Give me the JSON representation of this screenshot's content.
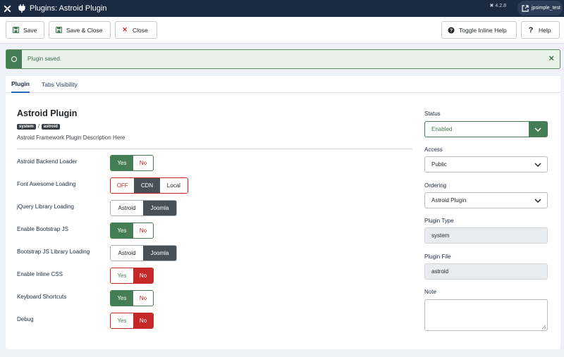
{
  "header": {
    "title": "Plugins: Astroid Plugin",
    "version": "4.2.8",
    "user": "jpsimple_test"
  },
  "toolbar": {
    "save": "Save",
    "save_close": "Save & Close",
    "close": "Close",
    "toggle_help": "Toggle Inline Help",
    "help": "Help"
  },
  "alert": {
    "message": "Plugin saved.",
    "close": "×"
  },
  "tabs": [
    {
      "label": "Plugin",
      "active": true
    },
    {
      "label": "Tabs Visibility",
      "active": false
    }
  ],
  "plugin": {
    "title": "Astroid Plugin",
    "badges": [
      "system",
      "astroid"
    ],
    "separator": "/",
    "description": "Astroid Framework Plugin Description Here"
  },
  "fields": [
    {
      "label": "Astroid Backend Loader",
      "options": [
        "Yes",
        "No"
      ],
      "selected": "Yes"
    },
    {
      "label": "Font Awesome Loading",
      "options": [
        "OFF",
        "CDN",
        "Local"
      ],
      "selected": "CDN"
    },
    {
      "label": "jQuery Library Loading",
      "options": [
        "Astroid",
        "Joomla"
      ],
      "selected": "Joomla"
    },
    {
      "label": "Enable Bootstrap JS",
      "options": [
        "Yes",
        "No"
      ],
      "selected": "Yes"
    },
    {
      "label": "Bootstrap JS Library Loading",
      "options": [
        "Astroid",
        "Joomla"
      ],
      "selected": "Joomla"
    },
    {
      "label": "Enable Inline CSS",
      "options": [
        "Yes",
        "No"
      ],
      "selected": "No"
    },
    {
      "label": "Keyboard Shortcuts",
      "options": [
        "Yes",
        "No"
      ],
      "selected": "Yes"
    },
    {
      "label": "Debug",
      "options": [
        "Yes",
        "No"
      ],
      "selected": "No"
    }
  ],
  "sidebar": {
    "status": {
      "label": "Status",
      "value": "Enabled"
    },
    "access": {
      "label": "Access",
      "value": "Public"
    },
    "ordering": {
      "label": "Ordering",
      "value": "Astroid Plugin"
    },
    "plugin_type": {
      "label": "Plugin Type",
      "value": "system"
    },
    "plugin_file": {
      "label": "Plugin File",
      "value": "astroid"
    },
    "note": {
      "label": "Note",
      "value": ""
    }
  },
  "colors": {
    "header_bg": "#1c2a41",
    "success": "#457d54",
    "danger": "#c52827",
    "dark_selected": "#495158"
  }
}
